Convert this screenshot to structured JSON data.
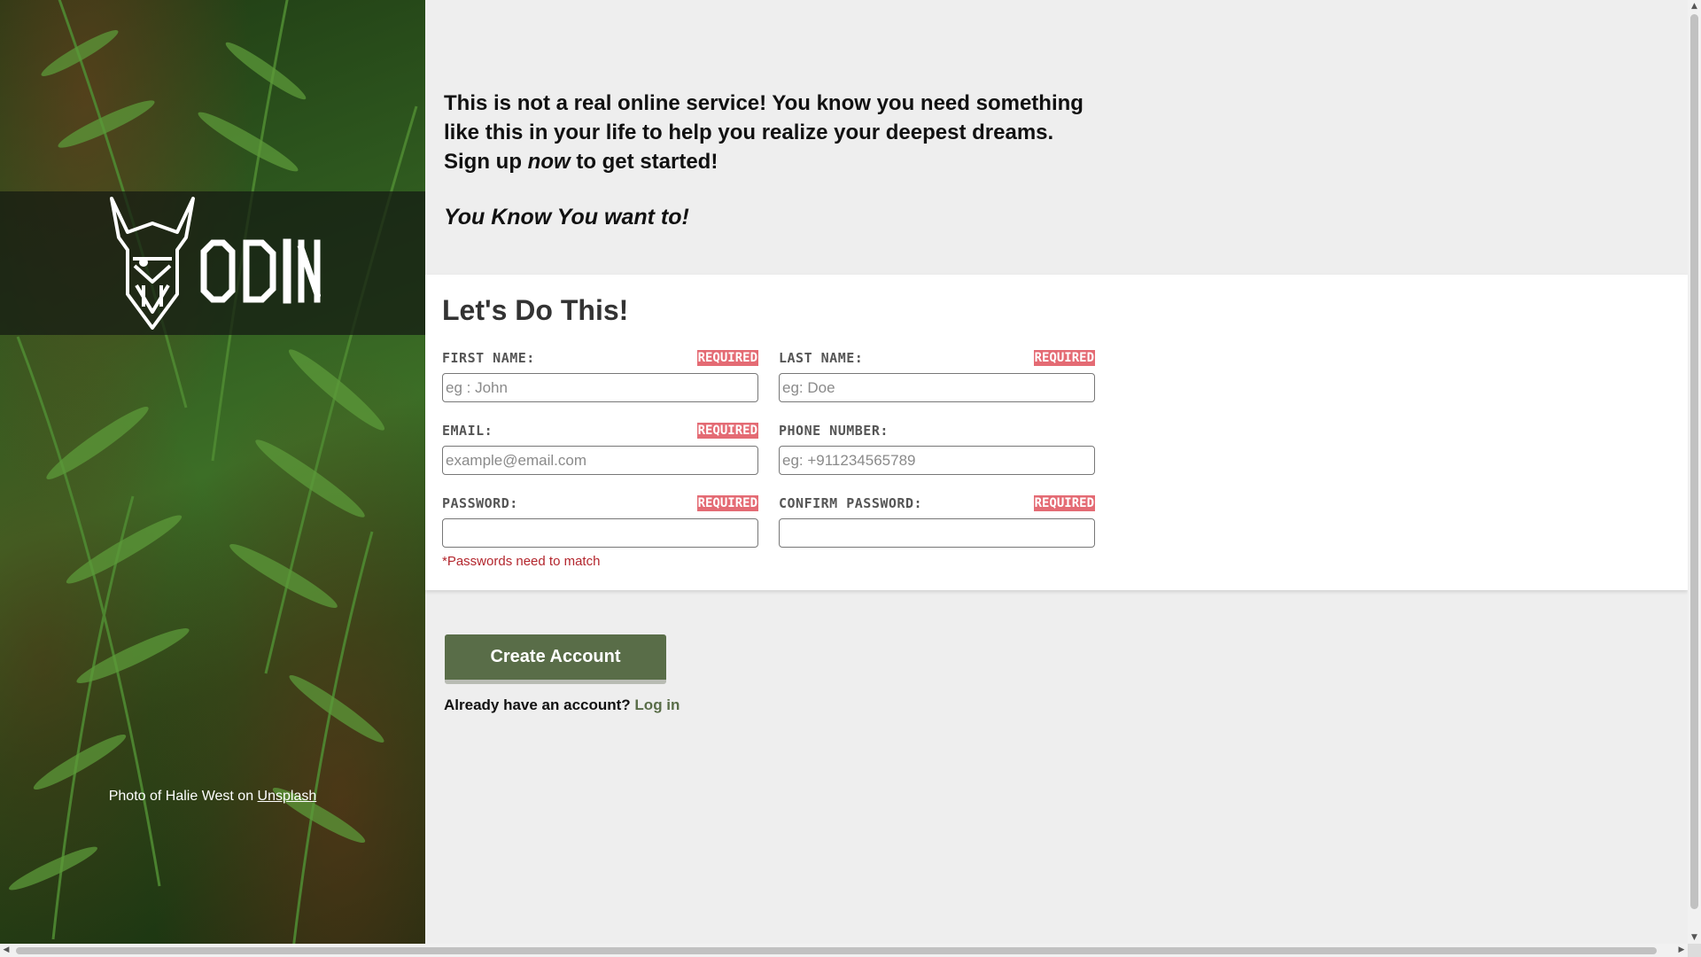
{
  "brand": {
    "logo_text": "ODIN"
  },
  "photo_credit": {
    "prefix": "Photo of Halie West on",
    "link": "Unsplash"
  },
  "intro": {
    "line1": "This is not a real online service! You know you need something",
    "line2": "like this in your life to help you realize your deepest dreams.",
    "line3_before": "Sign up",
    "line3_em": "now",
    "line3_after": "to get started!",
    "tagline": "You Know You want to!"
  },
  "form": {
    "title": "Let's Do This!",
    "required_label": "REQUIRED",
    "fields": {
      "first_name": {
        "label": "FIRST NAME:",
        "placeholder": "eg : John",
        "required": true
      },
      "last_name": {
        "label": "LAST NAME:",
        "placeholder": "eg: Doe",
        "required": true
      },
      "email": {
        "label": "EMAIL:",
        "placeholder": "example@email.com",
        "required": true
      },
      "phone": {
        "label": "PHONE NUMBER:",
        "placeholder": "eg: +911234565789",
        "required": false
      },
      "password": {
        "label": "PASSWORD:",
        "placeholder": "",
        "required": true
      },
      "confirm_password": {
        "label": "CONFIRM PASSWORD:",
        "placeholder": "",
        "required": true
      }
    },
    "password_note": "*Passwords need to match"
  },
  "actions": {
    "create_account": "Create Account",
    "login_prompt": "Already have an account?",
    "login_link": "Log in"
  },
  "colors": {
    "accent": "#596d48",
    "required_badge": "#e46b74",
    "error_text": "#b3262d",
    "page_background": "#eeeeee"
  }
}
